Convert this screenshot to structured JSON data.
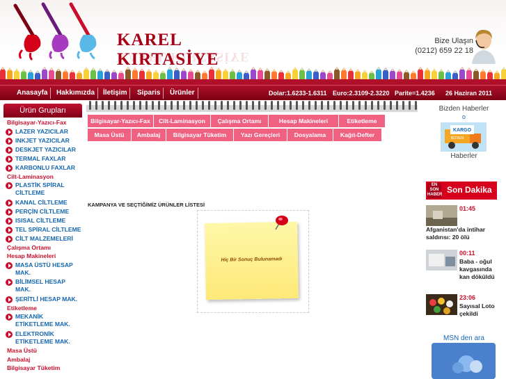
{
  "header": {
    "logo_text": "KAREL KIRTASİYE",
    "contact_label": "Bize Ulaşın",
    "contact_phone": "(0212) 659 22 18"
  },
  "navbar": {
    "items": [
      "Anasayfa",
      "Hakkımızda",
      "İletişim",
      "Siparis",
      "Ürünler"
    ],
    "dolar": "Dolar:1.6233-1.6311",
    "euro": "Euro:2.3109-2.3220",
    "parite": "Parite=1.4236",
    "date": "26 Haziran 2011"
  },
  "sidebar": {
    "title": "Ürün Grupları",
    "entries": [
      {
        "type": "head",
        "label": "Bilgisayar-Yazıcı-Fax"
      },
      {
        "type": "item",
        "label": "LAZER YAZICILAR"
      },
      {
        "type": "item",
        "label": "INKJET YAZICILAR"
      },
      {
        "type": "item",
        "label": "DESKJET YAZICILAR"
      },
      {
        "type": "item",
        "label": "TERMAL FAXLAR"
      },
      {
        "type": "item",
        "label": "KARBONLU FAXLAR"
      },
      {
        "type": "head",
        "label": "Cilt-Laminasyon"
      },
      {
        "type": "item",
        "label": "PLASTİK SPİRAL CİLTLEME"
      },
      {
        "type": "item",
        "label": "KANAL CİLTLEME"
      },
      {
        "type": "item",
        "label": "PERÇİN CİLTLEME"
      },
      {
        "type": "item",
        "label": "ISISAL CİLTLEME"
      },
      {
        "type": "item",
        "label": "TEL SPİRAL CİLTLEME"
      },
      {
        "type": "item",
        "label": "CİLT MALZEMELERİ"
      },
      {
        "type": "head",
        "label": "Çalışma Ortamı"
      },
      {
        "type": "head",
        "label": "Hesap Makineleri"
      },
      {
        "type": "item",
        "label": "MASA ÜSTÜ HESAP MAK."
      },
      {
        "type": "item",
        "label": "BİLİMSEL HESAP MAK."
      },
      {
        "type": "item",
        "label": "ŞERİTLİ HESAP MAK."
      },
      {
        "type": "head",
        "label": "Etiketleme"
      },
      {
        "type": "item",
        "label": "MEKANİK ETİKETLEME MAK."
      },
      {
        "type": "item",
        "label": "ELEKTRONİK ETİKETLEME MAK."
      },
      {
        "type": "head",
        "label": "Masa Üstü"
      },
      {
        "type": "head",
        "label": "Ambalaj"
      },
      {
        "type": "head",
        "label": "Bilgisayar Tüketim"
      }
    ]
  },
  "tabs": {
    "row1": [
      "Bilgisayar-Yazıcı-Fax",
      "Cilt-Laminasyon",
      "Çalışma Ortamı",
      "Hesap Makineleri",
      "Etiketleme"
    ],
    "row2": [
      "Masa Üstü",
      "Ambalaj",
      "Bilgisayar Tüketim",
      "Yazı Gereçleri",
      "Dosyalama",
      "Kağıt-Defter"
    ]
  },
  "main": {
    "campaign_title": "KAMPANYA VE SEÇTİĞİMİZ ÜRÜNLER LİSTESİ",
    "empty_note": "Hiç Bir Sonuç Bulunamadı"
  },
  "right": {
    "news_title": "Bizden Haberler",
    "news_dot": "o",
    "kargo_text": "KARGO",
    "kargo_sub": "BİZDEN",
    "news_sub": "Haberler",
    "sondakika_badge": "EN SON HABER",
    "sondakika_label": "Son Dakika",
    "news": [
      {
        "time": "01:45",
        "text": "Afganistan'da intihar saldırısı: 20 ölü"
      },
      {
        "time": "00:11",
        "text": "Baba - oğul kavgasında kan döküldü"
      },
      {
        "time": "23:06",
        "text": "Sayısal Loto çekildi"
      }
    ],
    "msn_title": "MSN den ara"
  },
  "colors": {
    "brand": "#a80016",
    "accent": "#f06080",
    "link": "#1466b0"
  }
}
